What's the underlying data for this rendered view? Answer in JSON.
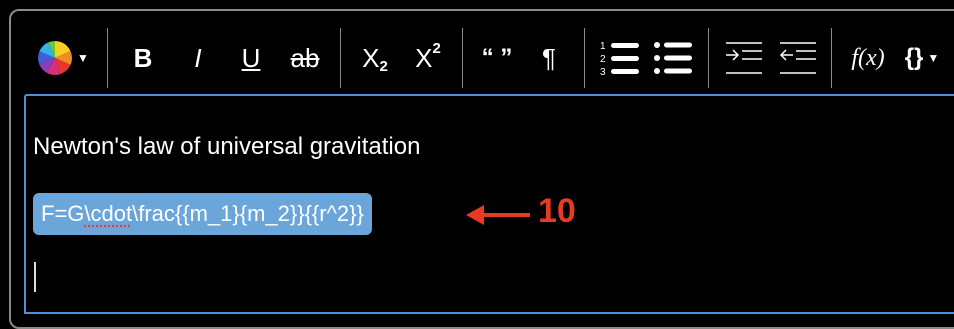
{
  "toolbar": {
    "bold": "B",
    "italic": "I",
    "underline": "U",
    "strikethrough": "ab",
    "subscript_base": "X",
    "subscript_mark": "2",
    "superscript_base": "X",
    "superscript_mark": "2",
    "quote": "“ ”",
    "paragraph": "¶",
    "numbered_list_numbers": [
      "1",
      "2",
      "3"
    ],
    "formula": "f(x)",
    "code": "{}"
  },
  "editor": {
    "line1": "Newton's law of universal gravitation",
    "formula_prefix": "F=G",
    "formula_flagged": "\\cdot",
    "formula_rest": "\\frac{{m_1}{m_2}}{{r^2}}"
  },
  "annotation": {
    "label": "10",
    "color": "#e83a23"
  },
  "colors": {
    "selection": "#6ba6da",
    "editor_border": "#4d8fd6"
  }
}
